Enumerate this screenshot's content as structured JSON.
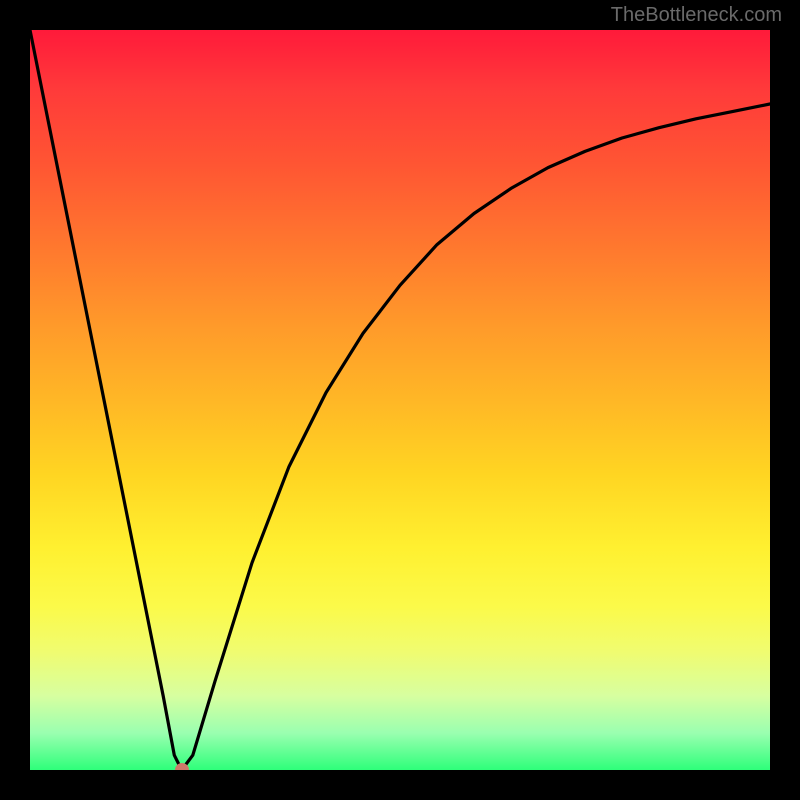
{
  "watermark": "TheBottleneck.com",
  "chart_data": {
    "type": "line",
    "title": "",
    "xlabel": "",
    "ylabel": "",
    "xlim": [
      0,
      100
    ],
    "ylim": [
      0,
      100
    ],
    "series": [
      {
        "name": "bottleneck-curve",
        "x": [
          0,
          5,
          10,
          15,
          18,
          19.5,
          20.5,
          22,
          25,
          30,
          35,
          40,
          45,
          50,
          55,
          60,
          65,
          70,
          75,
          80,
          85,
          90,
          95,
          100
        ],
        "y": [
          100,
          75,
          50,
          25,
          10,
          2,
          0,
          2,
          12,
          28,
          41,
          51,
          59,
          65.5,
          71,
          75.2,
          78.6,
          81.4,
          83.6,
          85.4,
          86.8,
          88,
          89,
          90
        ]
      }
    ],
    "marker": {
      "x": 20.5,
      "y": 0,
      "label": "optimal-point"
    },
    "gradient_stops": [
      {
        "pct": 0,
        "color": "#ff1a3a"
      },
      {
        "pct": 18,
        "color": "#ff5533"
      },
      {
        "pct": 40,
        "color": "#ff9a2a"
      },
      {
        "pct": 60,
        "color": "#ffd522"
      },
      {
        "pct": 78,
        "color": "#fbfa4a"
      },
      {
        "pct": 95,
        "color": "#9affb0"
      },
      {
        "pct": 100,
        "color": "#2eff7a"
      }
    ]
  }
}
